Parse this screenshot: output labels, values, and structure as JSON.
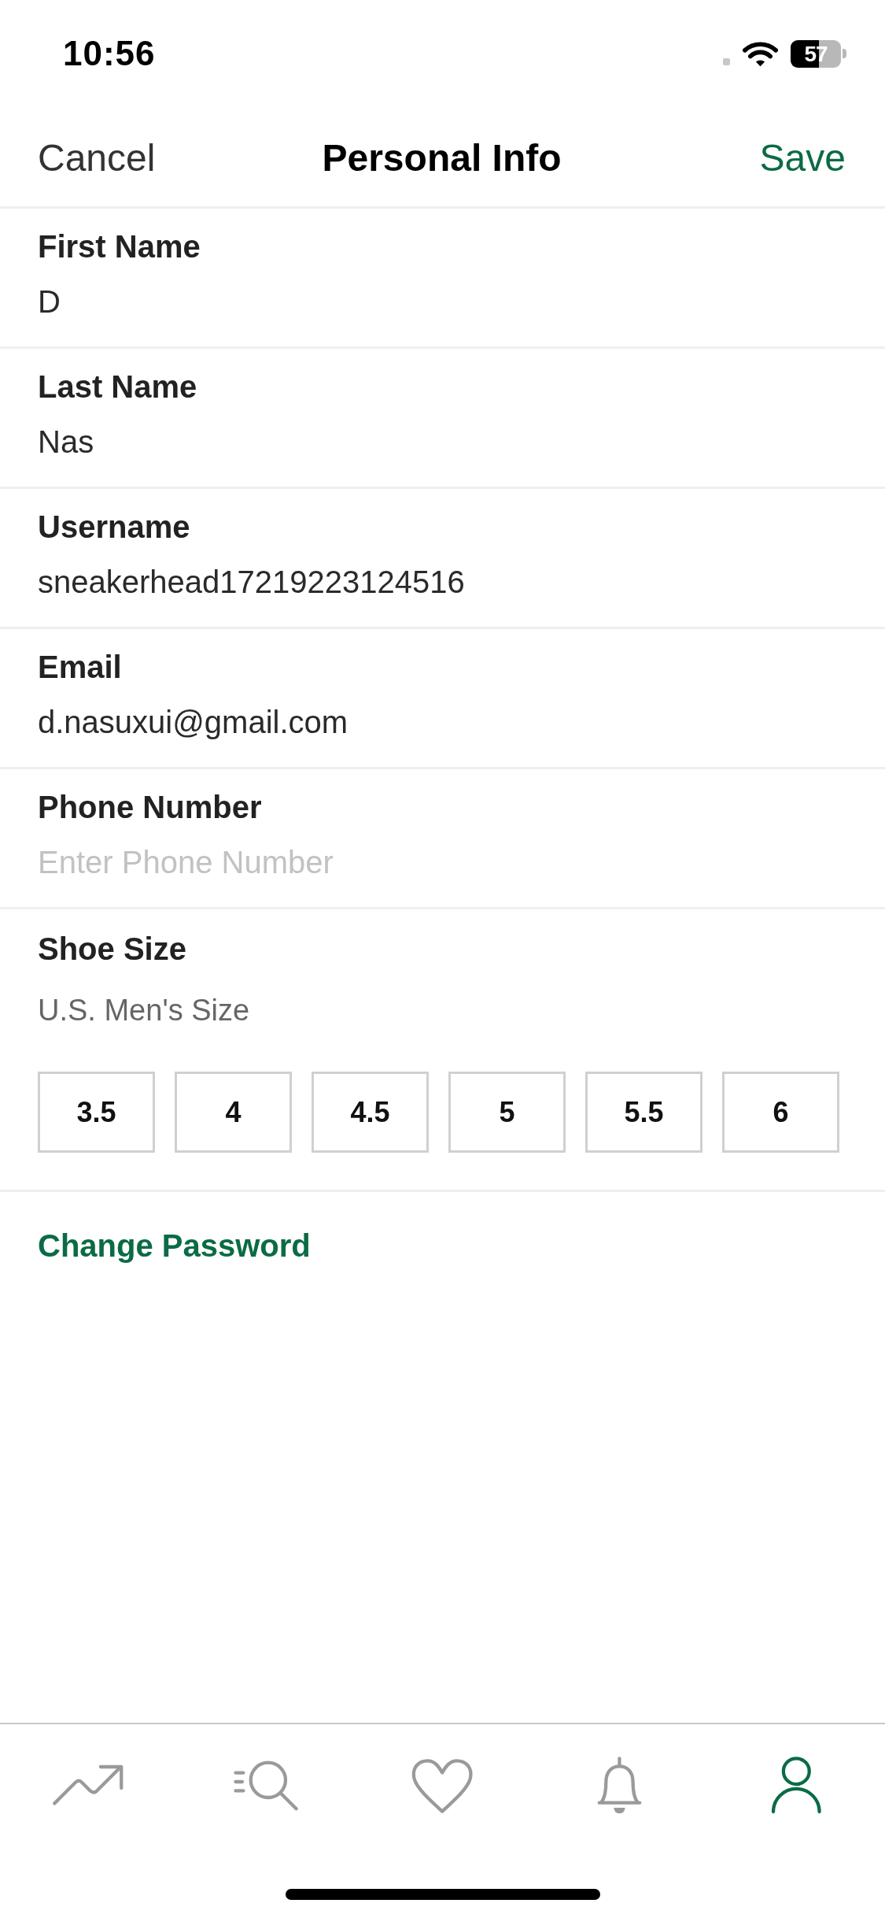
{
  "status_bar": {
    "time": "10:56",
    "battery": "57"
  },
  "nav": {
    "cancel": "Cancel",
    "title": "Personal Info",
    "save": "Save"
  },
  "fields": [
    {
      "label": "First Name",
      "value": "D"
    },
    {
      "label": "Last Name",
      "value": "Nas"
    },
    {
      "label": "Username",
      "value": "sneakerhead17219223124516"
    },
    {
      "label": "Email",
      "value": "d.nasuxui@gmail.com"
    },
    {
      "label": "Phone Number",
      "placeholder": "Enter Phone Number"
    }
  ],
  "shoe_size": {
    "label": "Shoe Size",
    "subtitle": "U.S. Men's Size",
    "sizes": [
      {
        "label": "3.5",
        "selected": false
      },
      {
        "label": "4",
        "selected": false
      },
      {
        "label": "4.5",
        "selected": false
      },
      {
        "label": "5",
        "selected": false
      },
      {
        "label": "5.5",
        "selected": false
      },
      {
        "label": "6",
        "selected": false
      }
    ]
  },
  "change_password": "Change Password",
  "tab_bar": [
    {
      "kind": "trending",
      "selected": false
    },
    {
      "kind": "search",
      "selected": false
    },
    {
      "kind": "favorites",
      "selected": false
    },
    {
      "kind": "notifications",
      "selected": false
    },
    {
      "kind": "profile",
      "selected": true
    }
  ]
}
